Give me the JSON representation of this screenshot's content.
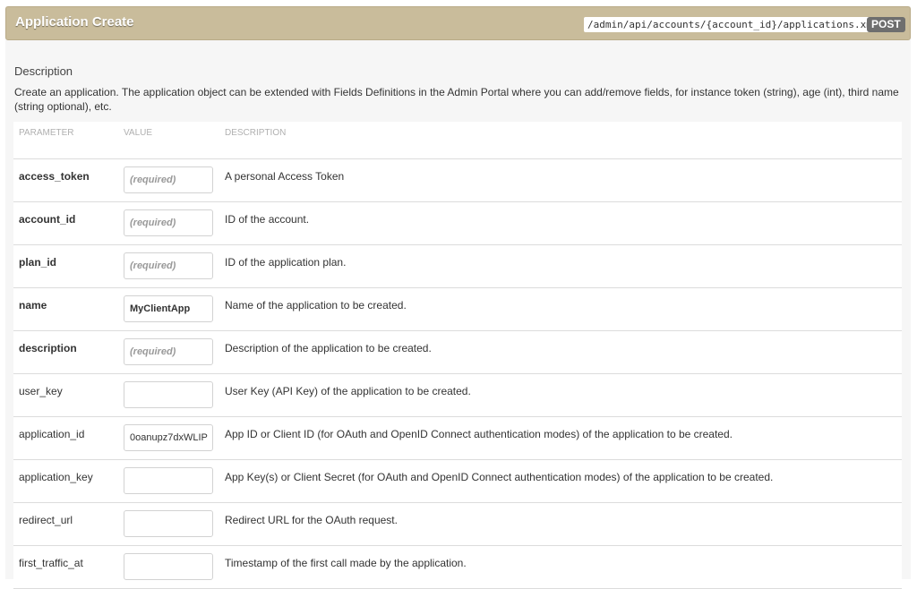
{
  "header": {
    "title": "Application Create",
    "endpoint": "/admin/api/accounts/{account_id}/applications.xml",
    "method": "POST"
  },
  "description": {
    "heading": "Description",
    "text": "Create an application. The application object can be extended with Fields Definitions in the Admin Portal where you can add/remove fields, for instance token (string), age (int), third name (string optional), etc."
  },
  "table": {
    "headers": {
      "parameter": "PARAMETER",
      "value": "VALUE",
      "description": "DESCRIPTION"
    },
    "rows": [
      {
        "name": "access_token",
        "placeholder": "(required)",
        "value": "",
        "description": "A personal Access Token"
      },
      {
        "name": "account_id",
        "placeholder": "(required)",
        "value": "",
        "description": "ID of the account."
      },
      {
        "name": "plan_id",
        "placeholder": "(required)",
        "value": "",
        "description": "ID of the application plan."
      },
      {
        "name": "name",
        "placeholder": "",
        "value": "MyClientApp",
        "description": "Name of the application to be created."
      },
      {
        "name": "description",
        "placeholder": "(required)",
        "value": "",
        "description": "Description of the application to be created."
      },
      {
        "name": "user_key",
        "placeholder": "",
        "value": "",
        "description": "User Key (API Key) of the application to be created."
      },
      {
        "name": "application_id",
        "placeholder": "",
        "value": "0oanupz7dxWLIP",
        "description": "App ID or Client ID (for OAuth and OpenID Connect authentication modes) of the application to be created."
      },
      {
        "name": "application_key",
        "placeholder": "",
        "value": "",
        "description": "App Key(s) or Client Secret (for OAuth and OpenID Connect authentication modes) of the application to be created."
      },
      {
        "name": "redirect_url",
        "placeholder": "",
        "value": "",
        "description": "Redirect URL for the OAuth request."
      },
      {
        "name": "first_traffic_at",
        "placeholder": "",
        "value": "",
        "description": "Timestamp of the first call made by the application."
      }
    ]
  }
}
